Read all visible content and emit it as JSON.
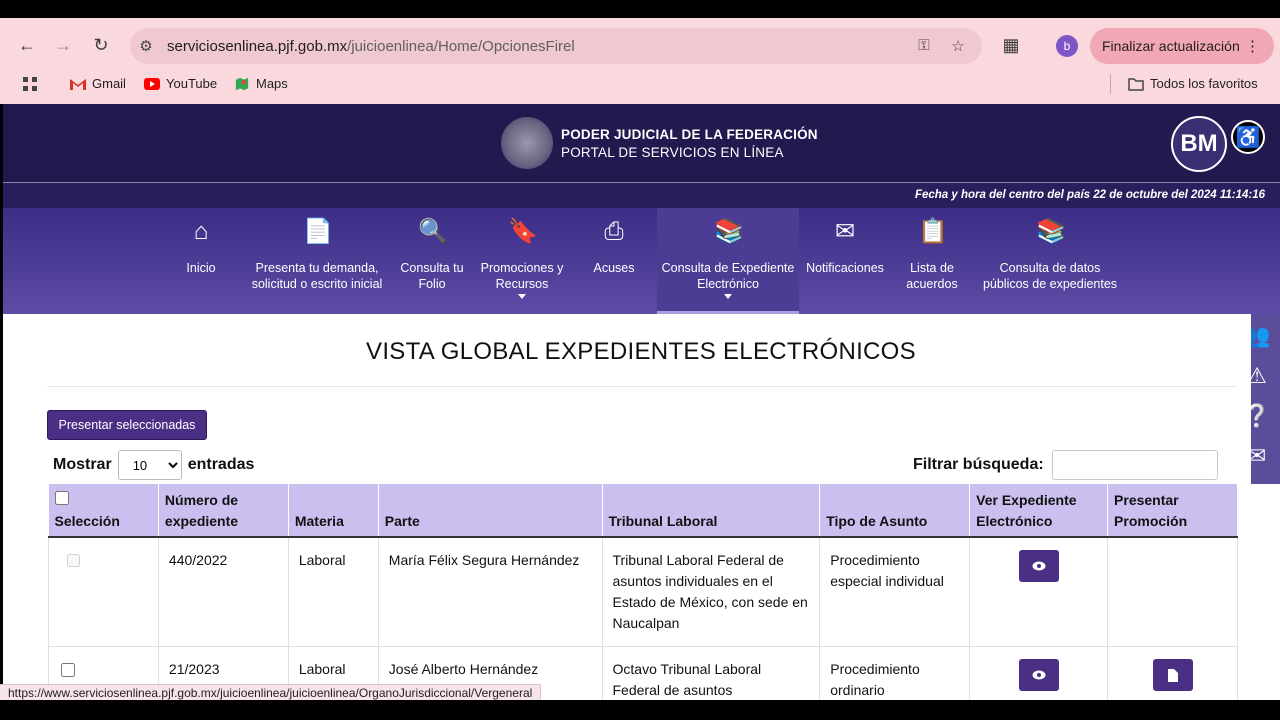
{
  "browser": {
    "url_host": "serviciosenlinea.pjf.gob.mx",
    "url_path": "/juicioenlinea/Home/OpcionesFirel",
    "profile_initial": "b",
    "update_label": "Finalizar actualización",
    "bookmarks": [
      "Gmail",
      "YouTube",
      "Maps"
    ],
    "all_favorites": "Todos los favoritos"
  },
  "header": {
    "title": "PODER JUDICIAL DE LA FEDERACIÓN",
    "subtitle": "PORTAL DE SERVICIOS EN LÍNEA",
    "logo_text": "BM",
    "datetime": "Fecha y hora del centro del país 22 de octubre del 2024 11:14:16"
  },
  "menu": [
    {
      "label": "Inicio"
    },
    {
      "label": "Presenta tu demanda, solicitud o escrito inicial"
    },
    {
      "label": "Consulta tu Folio"
    },
    {
      "label": "Promociones y Recursos"
    },
    {
      "label": "Acuses"
    },
    {
      "label": "Consulta de Expediente Electrónico"
    },
    {
      "label": "Notificaciones"
    },
    {
      "label": "Lista de acuerdos"
    },
    {
      "label": "Consulta de datos públicos de expedientes"
    }
  ],
  "page": {
    "title": "VISTA GLOBAL EXPEDIENTES ELECTRÓNICOS",
    "present_button": "Presentar seleccionadas",
    "show_label": "Mostrar",
    "page_size": "10",
    "entries_label": "entradas",
    "filter_label": "Filtrar búsqueda:"
  },
  "table": {
    "headers": [
      "Selección",
      "Número de expediente",
      "Materia",
      "Parte",
      "Tribunal Laboral",
      "Tipo de Asunto",
      "Ver Expediente Electrónico",
      "Presentar Promoción"
    ],
    "rows": [
      {
        "numero": "440/2022",
        "materia": "Laboral",
        "parte": "María Félix Segura Hernández",
        "tribunal": "Tribunal Laboral Federal de asuntos individuales en el Estado de México, con sede en Naucalpan",
        "tipo": "Procedimiento especial individual"
      },
      {
        "numero": "21/2023",
        "materia": "Laboral",
        "parte": "José Alberto Hernández",
        "tribunal": "Octavo Tribunal Laboral Federal de asuntos",
        "tipo": "Procedimiento ordinario"
      }
    ]
  },
  "status_url": "https://www.serviciosenlinea.pjf.gob.mx/juicioenlinea/juicioenlinea/OrganoJurisdiccional/Vergeneral"
}
